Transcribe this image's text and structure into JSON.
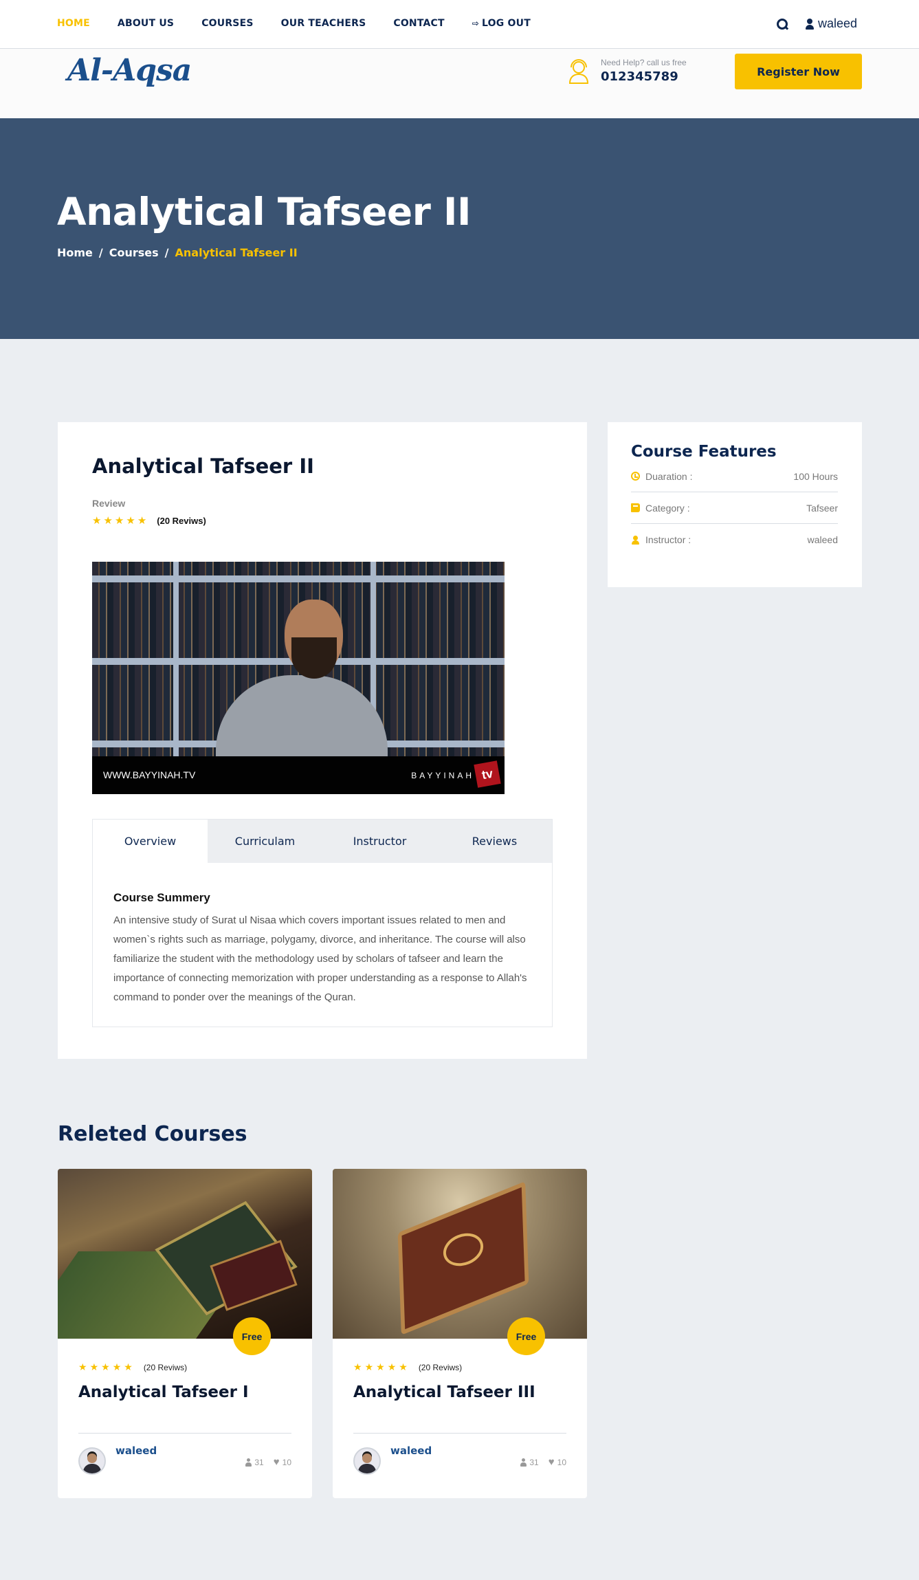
{
  "nav": {
    "items": [
      "HOME",
      "ABOUT US",
      "COURSES",
      "OUR TEACHERS",
      "CONTACT"
    ],
    "logout": "LOG OUT",
    "user": "waleed"
  },
  "brand": {
    "logo": "Al-Aqsa",
    "help_label": "Need Help? call us free",
    "phone": "012345789",
    "register": "Register Now"
  },
  "hero": {
    "title": "Analytical Tafseer II",
    "breadcrumb": [
      "Home",
      "Courses",
      "Analytical Tafseer II"
    ]
  },
  "course": {
    "title": "Analytical Tafseer II",
    "review_label": "Review",
    "rating": 5,
    "reviews": "(20 Reviws)",
    "video_caption_left": "WWW.BAYYINAH.TV",
    "video_caption_right": "BAYYINAH",
    "video_logo": "tv",
    "tabs": [
      "Overview",
      "Curriculam",
      "Instructor",
      "Reviews"
    ],
    "active_tab": "Overview",
    "summary_title": "Course Summery",
    "summary": "An intensive study of Surat ul Nisaa which covers important issues related to men and women`s rights such as marriage, polygamy, divorce, and inheritance. The course will also familiarize the student with the methodology used by scholars of tafseer and learn the importance of connecting memorization with proper understanding as a response to Allah's command to ponder over the meanings of the Quran."
  },
  "features": {
    "title": "Course Features",
    "rows": [
      {
        "label": "Duaration :",
        "value": "100 Hours",
        "icon": "clock-icon"
      },
      {
        "label": "Category :",
        "value": "Tafseer",
        "icon": "book-icon"
      },
      {
        "label": "Instructor :",
        "value": "waleed",
        "icon": "user-icon"
      }
    ]
  },
  "related": {
    "title": "Releted Courses",
    "cards": [
      {
        "badge": "Free",
        "rating": 5,
        "reviews": "(20 Reviws)",
        "title": "Analytical Tafseer I",
        "author": "waleed",
        "students": "31",
        "likes": "10"
      },
      {
        "badge": "Free",
        "rating": 5,
        "reviews": "(20 Reviws)",
        "title": "Analytical Tafseer III",
        "author": "waleed",
        "students": "31",
        "likes": "10"
      }
    ]
  },
  "colors": {
    "accent": "#f8c100",
    "navy": "#0d2650",
    "hero": "#3a5372"
  }
}
